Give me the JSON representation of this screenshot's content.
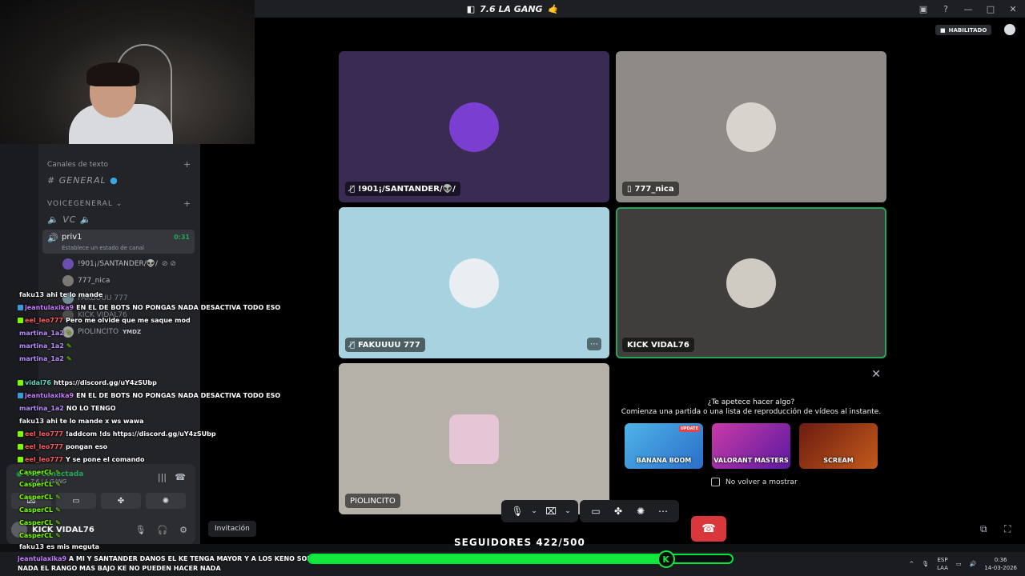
{
  "window": {
    "title": "7.6 LA GANG",
    "controls": [
      "—",
      "□",
      "✕"
    ]
  },
  "status": {
    "habilitado": "HABILITADO"
  },
  "sidebar": {
    "text_category": "Canales de texto",
    "text_channel": "GENERAL",
    "voice_category": "VOICEGENERAL",
    "voice_channel_vc": "VC",
    "active_voice": {
      "name": "priv1",
      "timer": "0:31",
      "status": "Establece un estado de canal"
    },
    "members": [
      {
        "name": "!901¡/SANTANDER/👽/",
        "color": "#6a4fb0"
      },
      {
        "name": "777_nica",
        "color": "#7d7874"
      },
      {
        "name": "FAKUUUU 777",
        "color": "#a7d3e0"
      },
      {
        "name": "KICK VIDAL76",
        "color": "#6b6b68"
      },
      {
        "name": "PIOLINCITO",
        "color": "#c9c5bd"
      }
    ],
    "piolin_badge": "YMDZ"
  },
  "chat": [
    {
      "user": "faku13",
      "cls": "u-white",
      "text": "ahi te lo mande",
      "badge": ""
    },
    {
      "user": "jeantulaxika9",
      "cls": "u-purple",
      "text": "EN EL DE BOTS NO PONGAS NADA DESACTIVA TODO ESO",
      "badge": "#3a9ad9"
    },
    {
      "user": "eel_leo777",
      "cls": "u-red",
      "text": "Pero me olvide que me saque mod",
      "badge": "#7cfc00"
    },
    {
      "user": "martina_1a2",
      "cls": "u-violet",
      "text": "",
      "badge": ""
    },
    {
      "user": "martina_1a2",
      "cls": "u-violet",
      "text": "",
      "badge": ""
    },
    {
      "user": "martina_1a2",
      "cls": "u-violet",
      "text": "",
      "badge": ""
    },
    {
      "user": "vidal76",
      "cls": "u-teal",
      "text": "https://discord.gg/uY4zSUbp",
      "badge": "#7cfc00"
    },
    {
      "user": "jeantulaxika9",
      "cls": "u-purple",
      "text": "EN EL DE BOTS NO PONGAS NADA DESACTIVA TODO ESO",
      "badge": "#3a9ad9"
    },
    {
      "user": "martina_1a2",
      "cls": "u-violet",
      "text": "NO LO TENGO",
      "badge": ""
    },
    {
      "user": "faku13",
      "cls": "u-white",
      "text": "ahi te lo mande x ws wawa",
      "badge": ""
    },
    {
      "user": "eel_leo777",
      "cls": "u-red",
      "text": "!addcom !ds https://discord.gg/uY4zSUbp",
      "badge": "#7cfc00"
    },
    {
      "user": "eel_leo777",
      "cls": "u-red",
      "text": "pongan eso",
      "badge": "#7cfc00"
    },
    {
      "user": "eel_leo777",
      "cls": "u-red",
      "text": "Y se pone el comando",
      "badge": "#7cfc00"
    },
    {
      "user": "CasperCL",
      "cls": "u-green",
      "text": "",
      "badge": ""
    },
    {
      "user": "CasperCL",
      "cls": "u-green",
      "text": "",
      "badge": ""
    },
    {
      "user": "CasperCL",
      "cls": "u-green",
      "text": "",
      "badge": ""
    },
    {
      "user": "CasperCL",
      "cls": "u-green",
      "text": "",
      "badge": ""
    },
    {
      "user": "CasperCL",
      "cls": "u-green",
      "text": "",
      "badge": ""
    },
    {
      "user": "CasperCL",
      "cls": "u-green",
      "text": "",
      "badge": ""
    },
    {
      "user": "faku13",
      "cls": "u-white",
      "text": "es mis meguta",
      "badge": ""
    }
  ],
  "chat_bottom": {
    "user": "jeantulaxika9",
    "text": "A MI Y SANTANDER DANOS EL KE TENGA MAYOR Y A LOS KENO SON NADA EL RANGO MAS BAJO KE NO PUEDEN HACER NADA"
  },
  "userpanel": {
    "connected": "Voz conectada",
    "server": "7.6 LA GANG",
    "username": "KICK VIDAL76"
  },
  "tiles": [
    {
      "label": "!901¡/SANTANDER/👽/",
      "icon": "muted-icon",
      "bg": "#3a2b52",
      "avatar": "#7a3fd0"
    },
    {
      "label": "777_nica",
      "icon": "phone-icon",
      "bg": "#8e8a85",
      "avatar": "#d8d3cc"
    },
    {
      "label": "FAKUUUU 777",
      "icon": "muted-icon",
      "bg": "#a7d3e0",
      "avatar": "#e9eef2"
    },
    {
      "label": "KICK VIDAL76",
      "icon": "",
      "bg": "#3f3e3c",
      "avatar": "#cfcac2"
    },
    {
      "label": "PIOLINCITO",
      "icon": "",
      "bg": "#b6b1a8",
      "avatar": "#e6c6d6"
    }
  ],
  "activity": {
    "question": "¿Te apetece hacer algo?",
    "subtitle": "Comienza una partida o una lista de reproducción de vídeos al instante.",
    "cards": [
      {
        "title": "BANANA BOOM",
        "badge": "UPDATE",
        "color1": "#4fb3e8",
        "color2": "#2a6fc9"
      },
      {
        "title": "VALORANT MASTERS",
        "badge": "",
        "color1": "#c93aa8",
        "color2": "#5a1aa0"
      },
      {
        "title": "SCREAM",
        "badge": "",
        "color1": "#6b1c10",
        "color2": "#c45a1c"
      }
    ],
    "no_show": "No volver a mostrar"
  },
  "controls": {
    "invite": "Invitación"
  },
  "followers": {
    "label": "SEGUIDORES 422/500",
    "current": 422,
    "goal": 500
  },
  "tray": {
    "lang1": "ESP",
    "lang2": "LAA",
    "time": "0:36",
    "date": "14-03-2026"
  }
}
